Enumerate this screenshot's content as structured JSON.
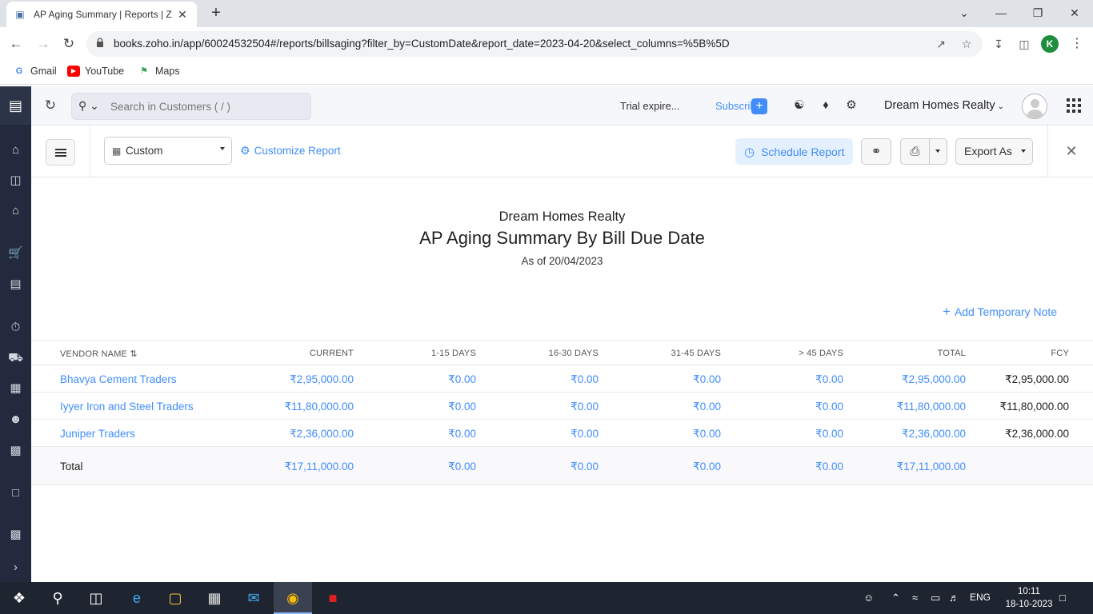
{
  "browser": {
    "tab_title": "AP Aging Summary | Reports | Z",
    "url": "books.zoho.in/app/60024532504#/reports/billsaging?filter_by=CustomDate&report_date=2023-04-20&select_columns=%5B%5D",
    "profile_initial": "K",
    "bookmarks": [
      "Gmail",
      "YouTube",
      "Maps"
    ]
  },
  "header": {
    "search_placeholder": "Search in Customers ( / )",
    "trial_text": "Trial expire...",
    "subscribe_label": "Subscribe",
    "org_name": "Dream Homes Realty"
  },
  "toolbar": {
    "date_filter": "Custom",
    "customize_label": "Customize Report",
    "schedule_label": "Schedule Report",
    "export_label": "Export As"
  },
  "report": {
    "org": "Dream Homes Realty",
    "title": "AP Aging Summary By Bill Due Date",
    "as_of": "As of 20/04/2023",
    "temp_note_label": "Add Temporary Note",
    "columns": [
      "VENDOR NAME",
      "CURRENT",
      "1-15 DAYS",
      "16-30 DAYS",
      "31-45 DAYS",
      "> 45 DAYS",
      "TOTAL",
      "FCY"
    ],
    "rows": [
      {
        "vendor": "Bhavya Cement Traders",
        "current": "₹2,95,000.00",
        "d1_15": "₹0.00",
        "d16_30": "₹0.00",
        "d31_45": "₹0.00",
        "d45": "₹0.00",
        "total": "₹2,95,000.00",
        "fcy": "₹2,95,000.00"
      },
      {
        "vendor": "Iyyer Iron and Steel Traders",
        "current": "₹11,80,000.00",
        "d1_15": "₹0.00",
        "d16_30": "₹0.00",
        "d31_45": "₹0.00",
        "d45": "₹0.00",
        "total": "₹11,80,000.00",
        "fcy": "₹11,80,000.00"
      },
      {
        "vendor": "Juniper Traders",
        "current": "₹2,36,000.00",
        "d1_15": "₹0.00",
        "d16_30": "₹0.00",
        "d31_45": "₹0.00",
        "d45": "₹0.00",
        "total": "₹2,36,000.00",
        "fcy": "₹2,36,000.00"
      }
    ],
    "total_row": {
      "label": "Total",
      "current": "₹17,11,000.00",
      "d1_15": "₹0.00",
      "d16_30": "₹0.00",
      "d31_45": "₹0.00",
      "d45": "₹0.00",
      "total": "₹17,11,000.00"
    }
  },
  "taskbar": {
    "language": "ENG",
    "time": "10:11",
    "date": "18-10-2023"
  },
  "colors": {
    "accent": "#408dfb",
    "rail": "#232a3d"
  }
}
